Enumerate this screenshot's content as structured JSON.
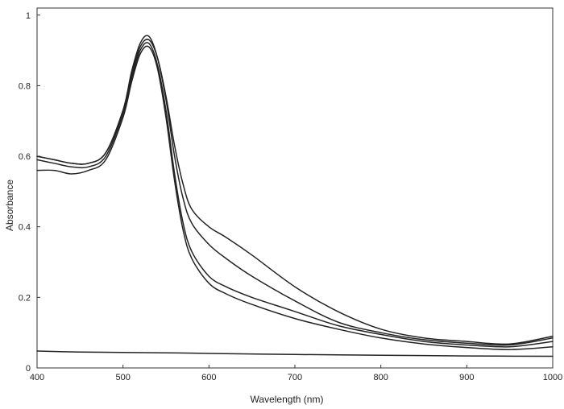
{
  "chart_data": {
    "type": "line",
    "title": "",
    "xlabel": "Wavelength (nm)",
    "ylabel": "Absorbance",
    "xlim": [
      400,
      1000
    ],
    "ylim": [
      0,
      1.02
    ],
    "xticks": [
      400,
      500,
      600,
      700,
      800,
      900,
      1000
    ],
    "yticks": [
      0,
      0.2,
      0.4,
      0.6,
      0.8,
      1
    ],
    "ytick_labels": [
      "0",
      "0.2",
      "0.4",
      "0.6",
      "0.8",
      "1"
    ],
    "grid": false,
    "line_color": "#222222",
    "series": [
      {
        "x": [
          400,
          420,
          440,
          460,
          480,
          500,
          510,
          520,
          530,
          540,
          550,
          560,
          570,
          580,
          600,
          620,
          650,
          700,
          750,
          800,
          850,
          900,
          950,
          1000
        ],
        "y": [
          0.6,
          0.59,
          0.58,
          0.58,
          0.61,
          0.73,
          0.83,
          0.91,
          0.93,
          0.88,
          0.77,
          0.63,
          0.52,
          0.45,
          0.4,
          0.37,
          0.32,
          0.23,
          0.16,
          0.11,
          0.085,
          0.075,
          0.068,
          0.09
        ]
      },
      {
        "x": [
          400,
          420,
          440,
          460,
          480,
          500,
          510,
          520,
          530,
          540,
          550,
          560,
          570,
          580,
          600,
          620,
          650,
          700,
          750,
          800,
          850,
          900,
          950,
          1000
        ],
        "y": [
          0.6,
          0.59,
          0.58,
          0.58,
          0.61,
          0.73,
          0.84,
          0.92,
          0.94,
          0.88,
          0.76,
          0.6,
          0.48,
          0.41,
          0.35,
          0.31,
          0.26,
          0.19,
          0.13,
          0.1,
          0.08,
          0.07,
          0.065,
          0.085
        ]
      },
      {
        "x": [
          400,
          420,
          440,
          460,
          480,
          500,
          510,
          520,
          530,
          540,
          550,
          560,
          570,
          580,
          600,
          620,
          650,
          700,
          750,
          800,
          850,
          900,
          950,
          1000
        ],
        "y": [
          0.59,
          0.58,
          0.57,
          0.57,
          0.6,
          0.72,
          0.82,
          0.9,
          0.92,
          0.86,
          0.73,
          0.55,
          0.41,
          0.33,
          0.26,
          0.23,
          0.2,
          0.16,
          0.12,
          0.095,
          0.075,
          0.065,
          0.06,
          0.075
        ]
      },
      {
        "x": [
          400,
          420,
          440,
          460,
          480,
          500,
          510,
          520,
          530,
          540,
          550,
          560,
          570,
          580,
          600,
          620,
          650,
          700,
          750,
          800,
          850,
          900,
          950,
          1000
        ],
        "y": [
          0.56,
          0.56,
          0.55,
          0.56,
          0.59,
          0.71,
          0.81,
          0.89,
          0.91,
          0.85,
          0.71,
          0.53,
          0.39,
          0.31,
          0.24,
          0.21,
          0.18,
          0.14,
          0.11,
          0.085,
          0.068,
          0.058,
          0.052,
          0.06
        ]
      },
      {
        "x": [
          400,
          450,
          500,
          550,
          600,
          700,
          800,
          900,
          1000
        ],
        "y": [
          0.048,
          0.045,
          0.044,
          0.043,
          0.041,
          0.038,
          0.036,
          0.034,
          0.033
        ]
      }
    ]
  }
}
